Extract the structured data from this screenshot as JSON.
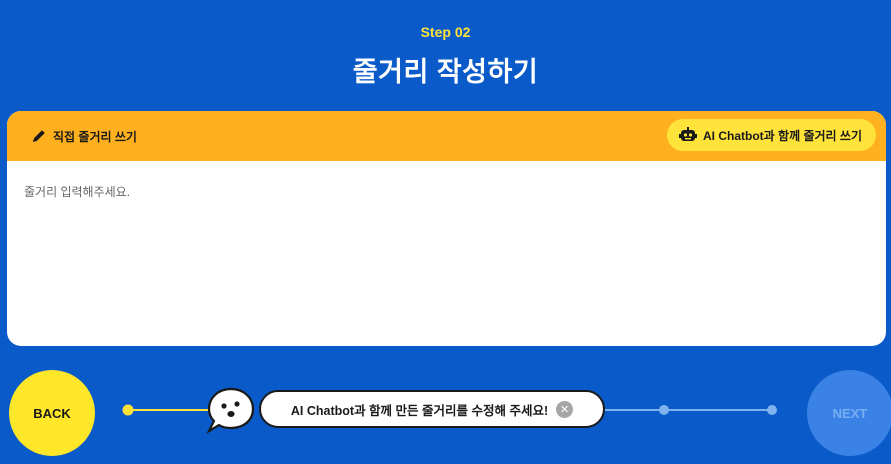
{
  "header": {
    "step": "Step 02",
    "title": "줄거리 작성하기"
  },
  "editor": {
    "mode_label": "직접 줄거리 쓰기",
    "ai_button_label": "AI Chatbot과 함께 줄거리 쓰기",
    "placeholder": "줄거리 입력해주세요."
  },
  "nav": {
    "back_label": "BACK",
    "next_label": "NEXT",
    "message": "AI Chatbot과 함께 만든 줄거리를 수정해 주세요!",
    "close_symbol": "✕"
  },
  "colors": {
    "background": "#0a5bc9",
    "accent_yellow": "#ffe23a",
    "bar_orange": "#ffb01f"
  }
}
